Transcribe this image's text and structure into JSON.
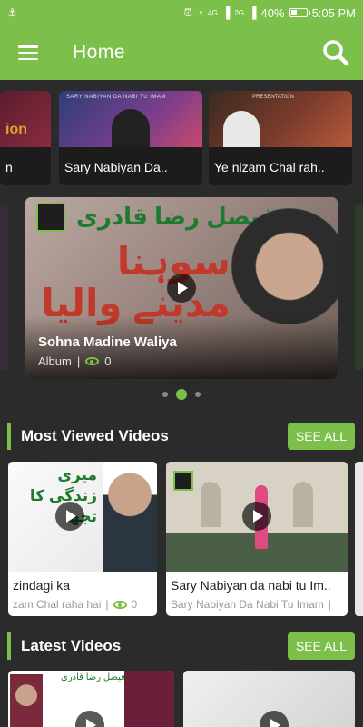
{
  "status_bar": {
    "usb_icon": "usb-icon",
    "alarm_icon": "alarm-icon",
    "wifi_icon": "wifi-icon",
    "signal_icon": "signal-icon",
    "net_1": "4G",
    "net_2": "2G",
    "battery_text": "40%",
    "battery_level": 0.4,
    "time": "5:05 PM"
  },
  "app_bar": {
    "title": "Home",
    "menu_icon": "hamburger-menu-icon",
    "search_icon": "search-icon"
  },
  "top_carousel": {
    "items": [
      {
        "label": "n",
        "overlay": "ion"
      },
      {
        "label": "Sary Nabiyan Da..",
        "overlay": "SARY NABIYAN DA NABI TU IMAM"
      },
      {
        "label": "Ye nizam Chal rah..",
        "overlay": "PRESENTATION"
      }
    ]
  },
  "featured": {
    "title": "Sohna Madine Waliya",
    "category": "Album",
    "separator": "|",
    "views": "0",
    "overlay_text": "فیصل رضا قادری",
    "overlay_big": "سوہنا مدینے والیا"
  },
  "pager": {
    "count": 3,
    "active": 1
  },
  "most_viewed": {
    "title": "Most Viewed Videos",
    "see_all": "SEE ALL",
    "items": [
      {
        "title": "zindagi ka",
        "subtitle": "zam Chal raha hai",
        "separator": "|",
        "views": "0",
        "overlay": "میری زندگی کا تجھ"
      },
      {
        "title": "Sary Nabiyan da nabi tu Im..",
        "subtitle": "Sary Nabiyan Da Nabi Tu Imam",
        "separator": "|",
        "views": ""
      }
    ]
  },
  "latest": {
    "title": "Latest Videos",
    "see_all": "SEE ALL",
    "items": [
      {
        "overlay": "فیصل رضا قادری"
      },
      {
        "overlay": ""
      }
    ]
  },
  "colors": {
    "accent": "#7cc04b",
    "background": "#2b2b2b",
    "card": "#ffffff"
  }
}
